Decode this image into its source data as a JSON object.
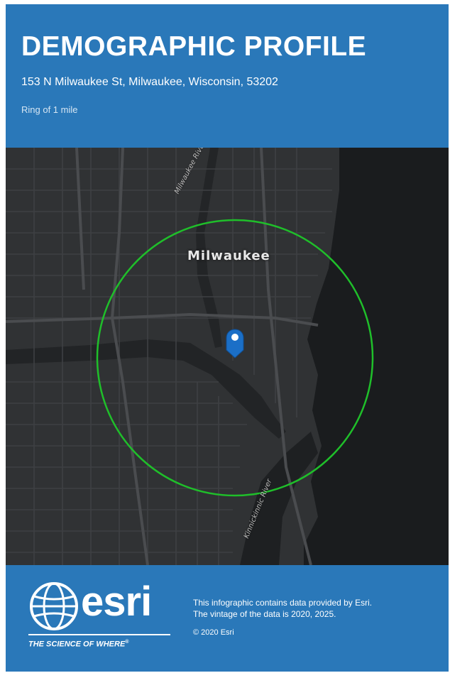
{
  "header": {
    "title": "DEMOGRAPHIC PROFILE",
    "address": "153 N Milwaukee St, Milwaukee, Wisconsin, 53202",
    "ring": "Ring of 1 mile"
  },
  "map": {
    "city_label": "Milwaukee",
    "river_labels": [
      "Milwaukee River",
      "Kinnickinnic River"
    ],
    "ring_color": "#1fbf2a",
    "pin_color": "#1b6fc7",
    "background_color": "#303234",
    "water_color": "#1a1c1e",
    "icons": [
      "location-pin-icon"
    ]
  },
  "footer": {
    "brand": "esri",
    "tagline": "THE SCIENCE OF WHERE",
    "tagline_mark": "®",
    "note_line1": "This infographic contains data provided by Esri.",
    "note_line2": "The vintage of the data is 2020, 2025.",
    "copyright": "© 2020 Esri",
    "brand_color": "#2a78b9",
    "icons": [
      "globe-icon"
    ]
  }
}
